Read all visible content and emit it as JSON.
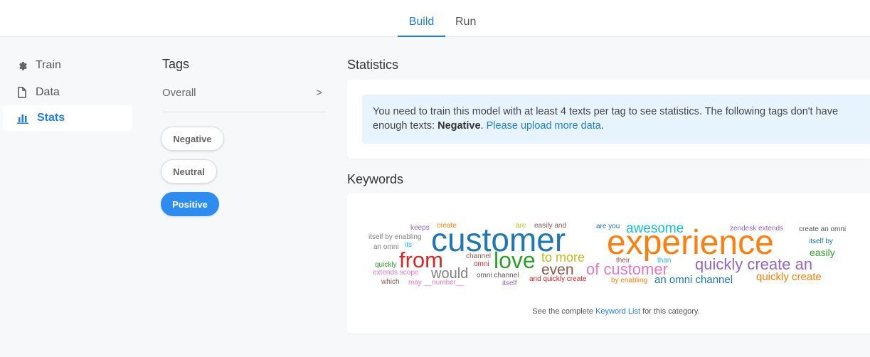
{
  "tabs": {
    "build": "Build",
    "run": "Run"
  },
  "sidebar": {
    "items": [
      {
        "label": "Train",
        "icon": "gear-icon"
      },
      {
        "label": "Data",
        "icon": "file-icon"
      },
      {
        "label": "Stats",
        "icon": "bar-chart-icon"
      }
    ]
  },
  "tags": {
    "title": "Tags",
    "overall": "Overall",
    "overall_chevron": ">",
    "list": [
      "Negative",
      "Neutral",
      "Positive"
    ]
  },
  "statistics": {
    "title": "Statistics",
    "alert_text": "You need to train this model with at least 4 texts per tag to see statistics. The following tags don't have enough texts: ",
    "alert_tag": "Negative",
    "alert_dot": ".",
    "alert_link": "Please upload more data",
    "alert_end": "."
  },
  "keywords": {
    "title": "Keywords",
    "caption_pre": "See the complete ",
    "caption_link": "Keyword List",
    "caption_post": " for this category.",
    "colors": [
      "#1f77b4",
      "#ff7f0e",
      "#d62728",
      "#2ca02c",
      "#9467bd",
      "#8c564b",
      "#e377c2",
      "#17becf",
      "#bcbd22",
      "#7f7f7f"
    ],
    "words": [
      "customer",
      "experience",
      "from",
      "love",
      "awesome",
      "quickly create an",
      "of customer",
      "even",
      "to more",
      "would",
      "an omni channel",
      "quickly create",
      "easily",
      "keeps",
      "create",
      "are",
      "easily and",
      "are you",
      "zendesk extends",
      "create an omni",
      "itself by enabling",
      "an omni",
      "its",
      "itself by",
      "channel",
      "omni",
      "their",
      "than",
      "quickly",
      "extends scope",
      "omni channel",
      "and quickly create",
      "by enabling",
      "which",
      "may",
      "__number__",
      "itself"
    ]
  }
}
